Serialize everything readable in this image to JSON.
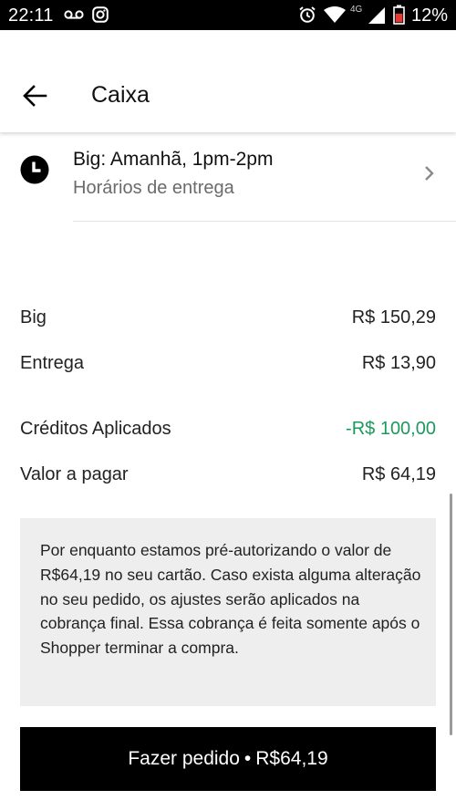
{
  "status_bar": {
    "time": "22:11",
    "network_label": "4G",
    "battery_percent": "12%",
    "icons": [
      "voicemail-icon",
      "instagram-icon",
      "alarm-icon",
      "wifi-icon",
      "cell-signal-icon",
      "battery-low-icon"
    ]
  },
  "header": {
    "title": "Caixa",
    "back_icon": "arrow-left-icon"
  },
  "delivery": {
    "icon": "clock-icon",
    "title": "Big: Amanhã, 1pm-2pm",
    "subtitle": "Horários de entrega",
    "chevron_icon": "chevron-right-icon"
  },
  "summary": {
    "store_label": "Big",
    "store_value": "R$ 150,29",
    "delivery_label": "Entrega",
    "delivery_value": "R$ 13,90",
    "credits_label": "Créditos Aplicados",
    "credits_value": "-R$ 100,00",
    "total_label": "Valor a pagar",
    "total_value": "R$ 64,19"
  },
  "notice": {
    "text": "Por enquanto estamos pré-autorizando o valor de R$64,19 no seu cartão. Caso exista alguma alteração no seu pedido, os ajustes serão aplicados na cobrança final. Essa cobrança é feita somente após o Shopper terminar a compra."
  },
  "place_order": {
    "label": "Fazer pedido",
    "separator": "•",
    "amount": "R$64,19"
  },
  "colors": {
    "credit_green": "#1c9a5c",
    "button_black": "#000000",
    "notice_background": "#eeeeee",
    "subtitle_gray": "#6b6b6b"
  }
}
